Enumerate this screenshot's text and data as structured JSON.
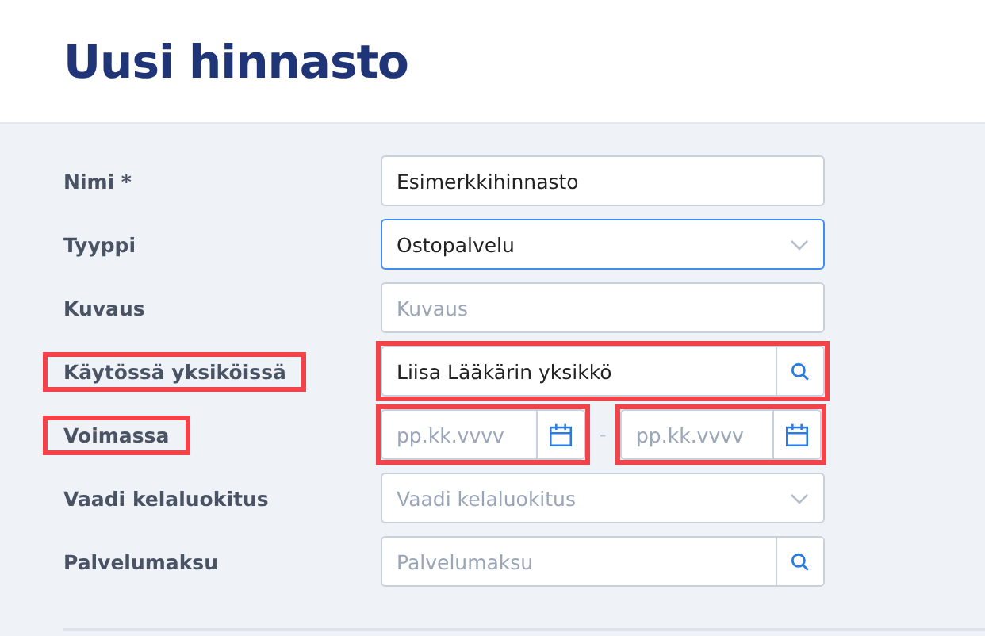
{
  "title": "Uusi hinnasto",
  "fields": [
    {
      "kind": "text",
      "label": "Nimi *",
      "value": "Esimerkkihinnasto",
      "focused": false,
      "highlighted": false
    },
    {
      "kind": "select",
      "label": "Tyyppi",
      "value": "Ostopalvelu",
      "focused": true,
      "highlighted": false
    },
    {
      "kind": "text",
      "label": "Kuvaus",
      "placeholder": "Kuvaus",
      "focused": false,
      "highlighted": false
    },
    {
      "kind": "search",
      "label": "Käytössä yksiköissä",
      "value": "Liisa Lääkärin yksikkö",
      "focused": false,
      "highlighted": true
    },
    {
      "kind": "daterange",
      "label": "Voimassa",
      "start_placeholder": "pp.kk.vvvv",
      "separator": "-",
      "end_placeholder": "pp.kk.vvvv",
      "focused": false,
      "highlighted": true
    },
    {
      "kind": "select",
      "label": "Vaadi kelaluokitus",
      "placeholder": "Vaadi kelaluokitus",
      "focused": false,
      "highlighted": false
    },
    {
      "kind": "search",
      "label": "Palvelumaksu",
      "placeholder": "Palvelumaksu",
      "focused": false,
      "highlighted": false
    }
  ]
}
